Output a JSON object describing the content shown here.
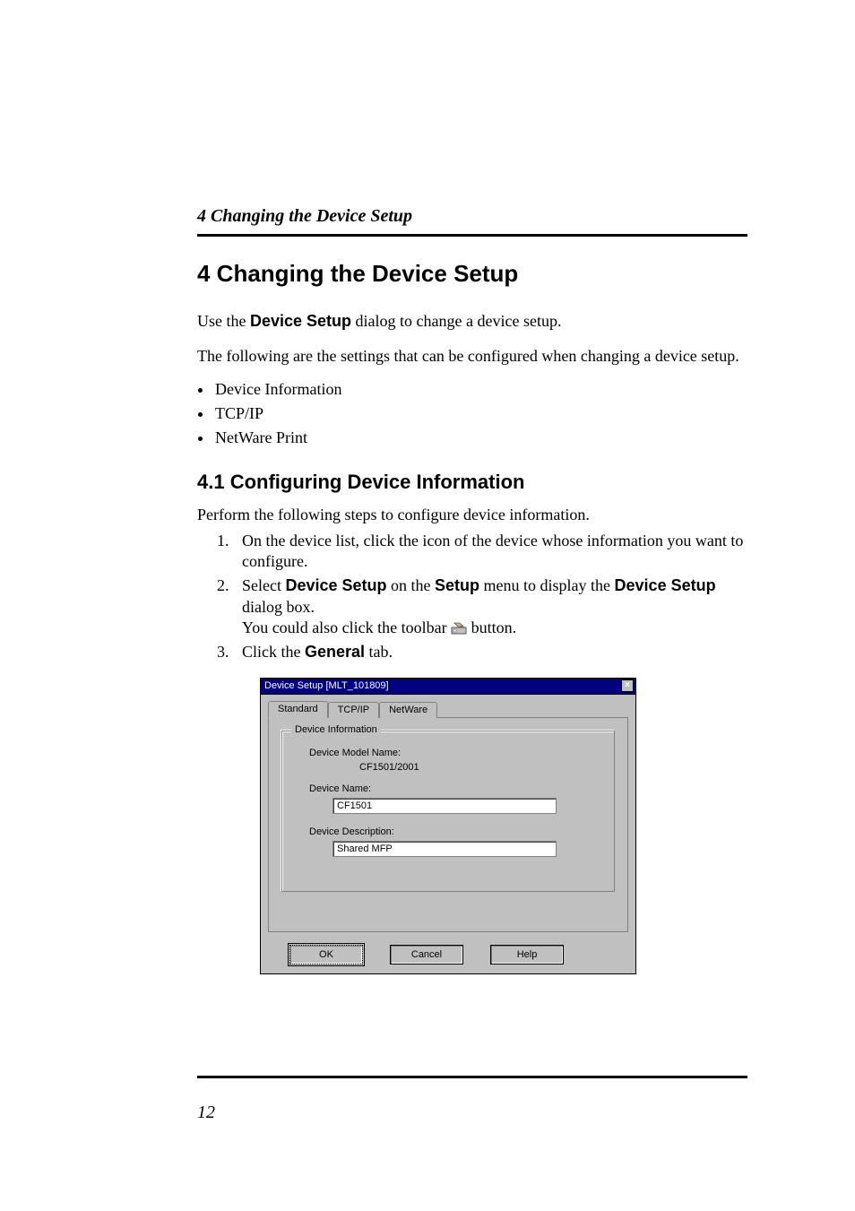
{
  "running_head": "4  Changing the Device Setup",
  "h1": "4  Changing the Device Setup",
  "intro1_pre": "Use the ",
  "intro1_bold": "Device Setup",
  "intro1_post": " dialog to change a device setup.",
  "intro2": "The following are the settings that can be configured when changing a device setup.",
  "bullets": [
    "Device Information",
    "TCP/IP",
    "NetWare Print"
  ],
  "h2": "4.1  Configuring Device Information",
  "lead": "Perform the following steps to configure device information.",
  "steps": {
    "s1": "On the device list, click the icon of the device whose information you want to configure.",
    "s2_a": "Select ",
    "s2_b1": "Device Setup",
    "s2_c": " on the ",
    "s2_b2": "Setup",
    "s2_d": " menu to display the ",
    "s2_b3": "Device Setup",
    "s2_e": " dialog box.",
    "s2_line2_pre": "You could also click the toolbar ",
    "s2_line2_post": " button.",
    "s3_a": "Click the ",
    "s3_b": "General",
    "s3_c": " tab."
  },
  "dialog": {
    "title": "Device Setup [MLT_101809]",
    "close": "×",
    "tabs": {
      "standard": "Standard",
      "tcpip": "TCP/IP",
      "netware": "NetWare"
    },
    "group_legend": "Device Information",
    "model_label": "Device Model Name:",
    "model_value": "CF1501/2001",
    "name_label": "Device Name:",
    "name_value": "CF1501",
    "desc_label": "Device Description:",
    "desc_value": "Shared MFP",
    "buttons": {
      "ok": "OK",
      "cancel": "Cancel",
      "help": "Help"
    }
  },
  "page_number": "12"
}
